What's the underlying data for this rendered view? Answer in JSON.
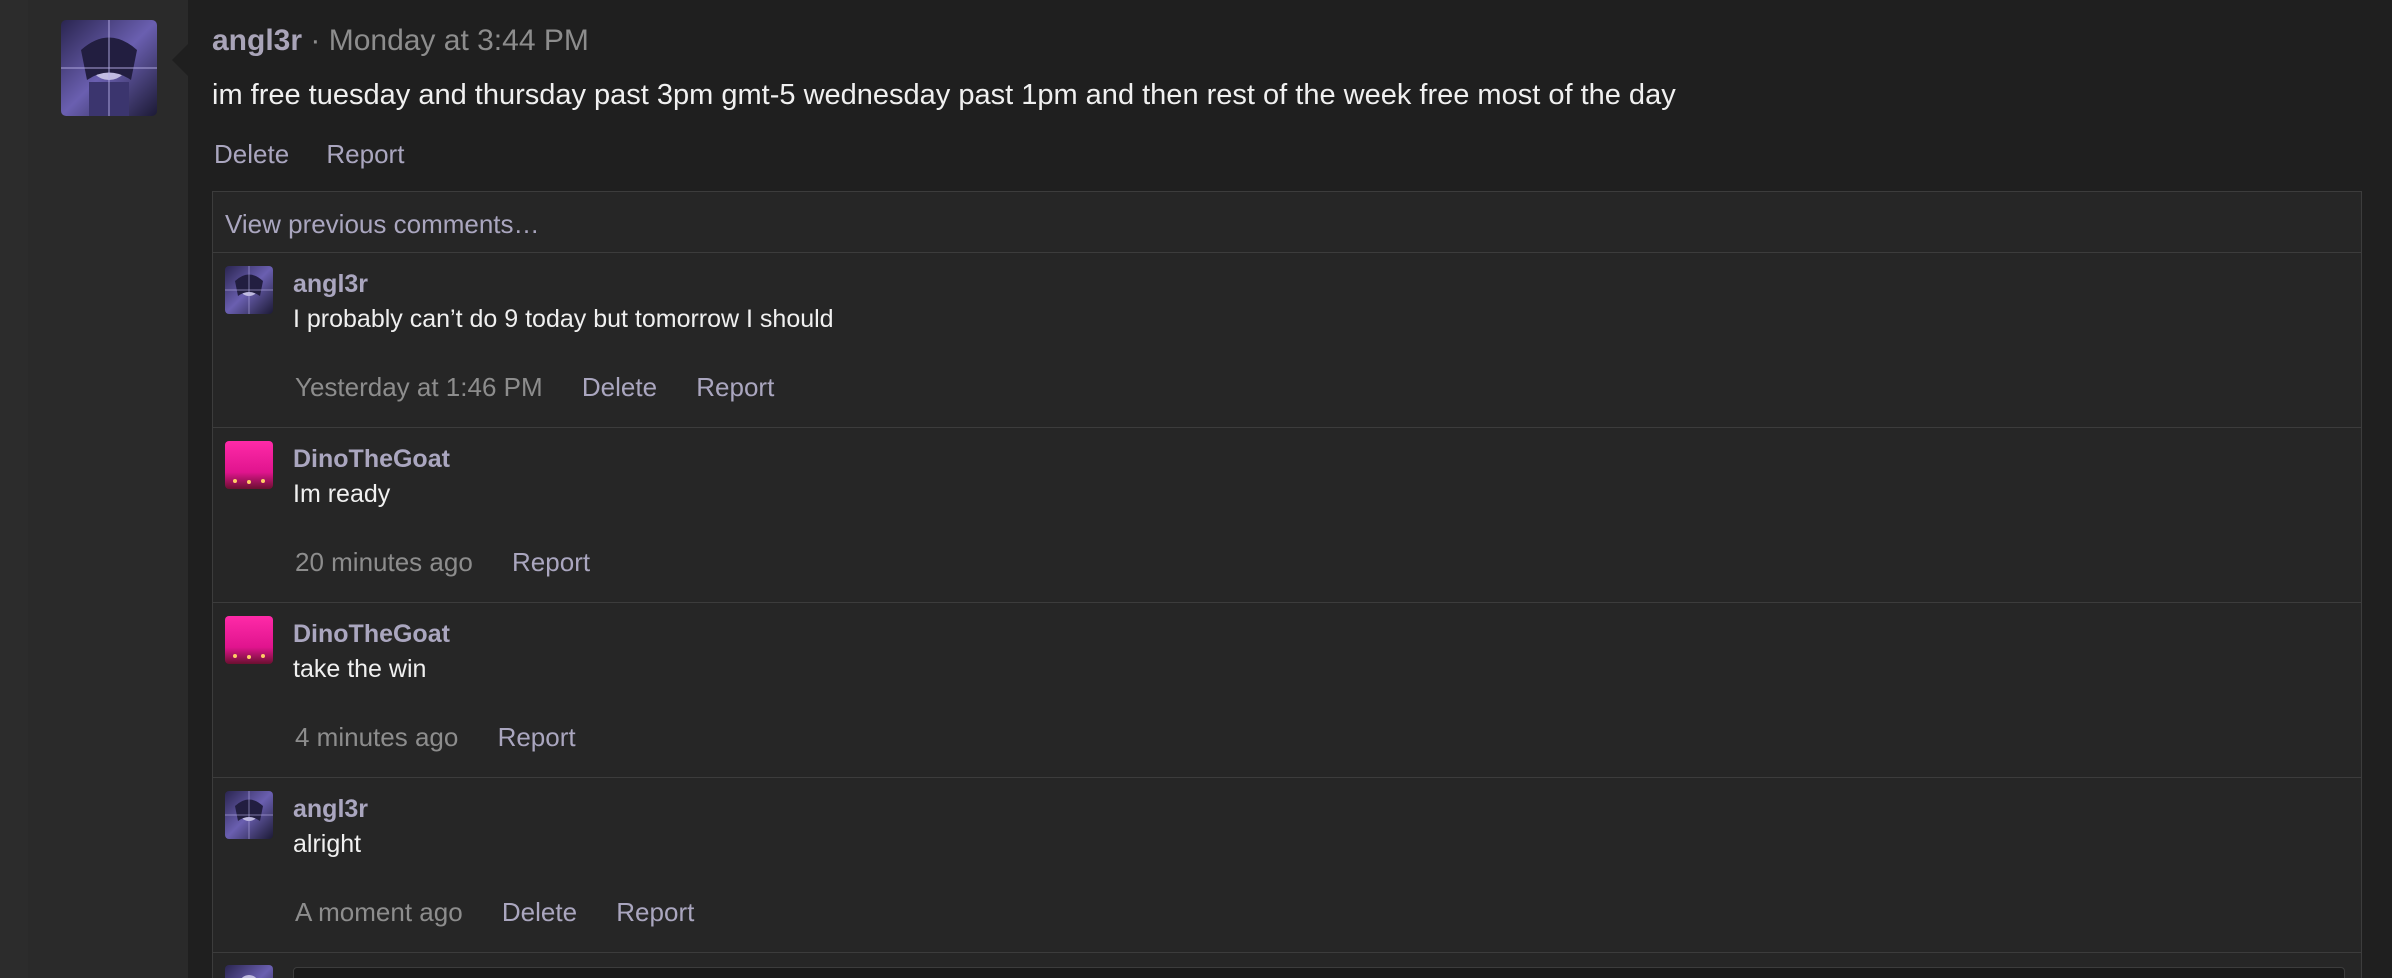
{
  "post": {
    "author": "angl3r",
    "separator": " · ",
    "timestamp": "Monday at 3:44 PM",
    "text": "im free tuesday and thursday past 3pm gmt-5 wednesday past 1pm and then rest of the week free most of the day",
    "actions": {
      "delete": "Delete",
      "report": "Report"
    }
  },
  "comments_section": {
    "view_previous": "View previous comments…",
    "comments": [
      {
        "author": "angl3r",
        "text": "I probably can’t do 9 today but tomorrow I should",
        "time": "Yesterday at 1:46 PM",
        "delete": "Delete",
        "report": "Report",
        "avatar": "anime-avatar"
      },
      {
        "author": "DinoTheGoat",
        "text": "Im ready",
        "time": "20 minutes ago",
        "report": "Report",
        "avatar": "pink-sunset-avatar"
      },
      {
        "author": "DinoTheGoat",
        "text": "take the win",
        "time": "4 minutes ago",
        "report": "Report",
        "avatar": "pink-sunset-avatar"
      },
      {
        "author": "angl3r",
        "text": "alright",
        "time": "A moment ago",
        "delete": "Delete",
        "report": "Report",
        "avatar": "anime-avatar"
      }
    ]
  },
  "colors": {
    "background": "#262626",
    "post_background": "#1f1f1f",
    "link": "#aaa6bf",
    "muted": "#8d8d8d",
    "text": "#f0f0f0"
  }
}
